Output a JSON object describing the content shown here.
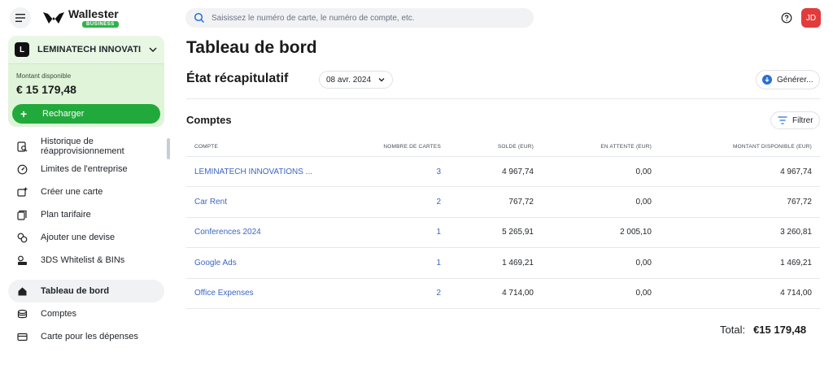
{
  "app": {
    "brand_name": "Wallester",
    "brand_badge": "BUSINESS"
  },
  "company": {
    "avatar_letter": "L",
    "name": "LEMINATECH INNOVATI...",
    "balance_label": "Montant disponible",
    "balance_value": "€ 15 179,48",
    "recharge_label": "Recharger"
  },
  "sidebar": {
    "items": [
      {
        "label": "Historique de réapprovisionnement",
        "icon": "history-search-icon"
      },
      {
        "label": "Limites de l'entreprise",
        "icon": "gauge-icon"
      },
      {
        "label": "Créer une carte",
        "icon": "add-card-icon"
      },
      {
        "label": "Plan tarifaire",
        "icon": "pricing-plan-icon"
      },
      {
        "label": "Ajouter une devise",
        "icon": "currency-icon"
      },
      {
        "label": "3DS Whitelist & BINs",
        "icon": "shield-list-icon"
      },
      {
        "label": "Tableau de bord",
        "icon": "home-icon",
        "active": true
      },
      {
        "label": "Comptes",
        "icon": "accounts-icon"
      },
      {
        "label": "Carte pour les dépenses",
        "icon": "card-icon"
      }
    ]
  },
  "search": {
    "placeholder": "Saisissez le numéro de carte, le numéro de compte, etc."
  },
  "user": {
    "initials": "JD"
  },
  "main": {
    "page_title": "Tableau de bord",
    "summary_title": "État récapitulatif",
    "date_value": "08 avr. 2024",
    "generate_label": "Générer...",
    "accounts_title": "Comptes",
    "filter_label": "Filtrer",
    "columns": [
      "COMPTE",
      "NOMBRE DE CARTES",
      "SOLDE (EUR)",
      "EN ATTENTE (EUR)",
      "MONTANT DISPONIBLE (EUR)"
    ],
    "rows": [
      {
        "account": "LEMINATECH INNOVATIONS ...",
        "cards": "3",
        "balance": "4 967,74",
        "pending": "0,00",
        "available": "4 967,74"
      },
      {
        "account": "Car Rent",
        "cards": "2",
        "balance": "767,72",
        "pending": "0,00",
        "available": "767,72"
      },
      {
        "account": "Conferences 2024",
        "cards": "1",
        "balance": "5 265,91",
        "pending": "2 005,10",
        "available": "3 260,81"
      },
      {
        "account": "Google Ads",
        "cards": "1",
        "balance": "1 469,21",
        "pending": "0,00",
        "available": "1 469,21"
      },
      {
        "account": "Office Expenses",
        "cards": "2",
        "balance": "4 714,00",
        "pending": "0,00",
        "available": "4 714,00"
      }
    ],
    "total_label": "Total:",
    "total_value": "€15 179,48"
  },
  "colors": {
    "accent_green": "#22a93b",
    "link_blue": "#3b66c4",
    "avatar_red": "#e23b3b"
  }
}
